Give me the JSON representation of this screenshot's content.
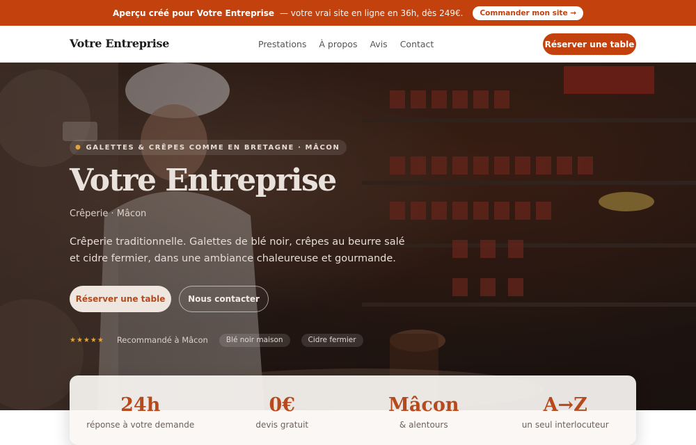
{
  "promo": {
    "bold_text": "Aperçu créé pour Votre Entreprise",
    "text": "— votre vrai site en ligne en 36h, dès 249€.",
    "button_label": "Commander mon site →"
  },
  "nav": {
    "brand": "Votre Entreprise",
    "links": [
      "Prestations",
      "À propos",
      "Avis",
      "Contact"
    ],
    "cta_label": "Réserver une table"
  },
  "hero": {
    "eyebrow": "GALETTES & CRÊPES COMME EN BRETAGNE · MÂCON",
    "title": "Votre Entreprise",
    "subtitle": "Crêperie · Mâcon",
    "description": "Crêperie traditionnelle. Galettes de blé noir, crêpes au beurre salé et cidre fermier, dans une ambiance chaleureuse et gourmande.",
    "primary_button": "Réserver une table",
    "secondary_button": "Nous contacter",
    "stars": "★★★★★",
    "rating": 5,
    "proof_text": "Recommandé à Mâcon",
    "chips": [
      "Blé noir maison",
      "Cidre fermier"
    ]
  },
  "stats": [
    {
      "value": "24h",
      "label": "réponse à votre demande"
    },
    {
      "value": "0€",
      "label": "devis gratuit"
    },
    {
      "value": "Mâcon",
      "label": "& alentours"
    },
    {
      "value": "A→Z",
      "label": "un seul interlocuteur"
    }
  ],
  "colors": {
    "accent": "#c2410c",
    "accent_text": "#b64a1d",
    "star": "#e2a33a"
  }
}
